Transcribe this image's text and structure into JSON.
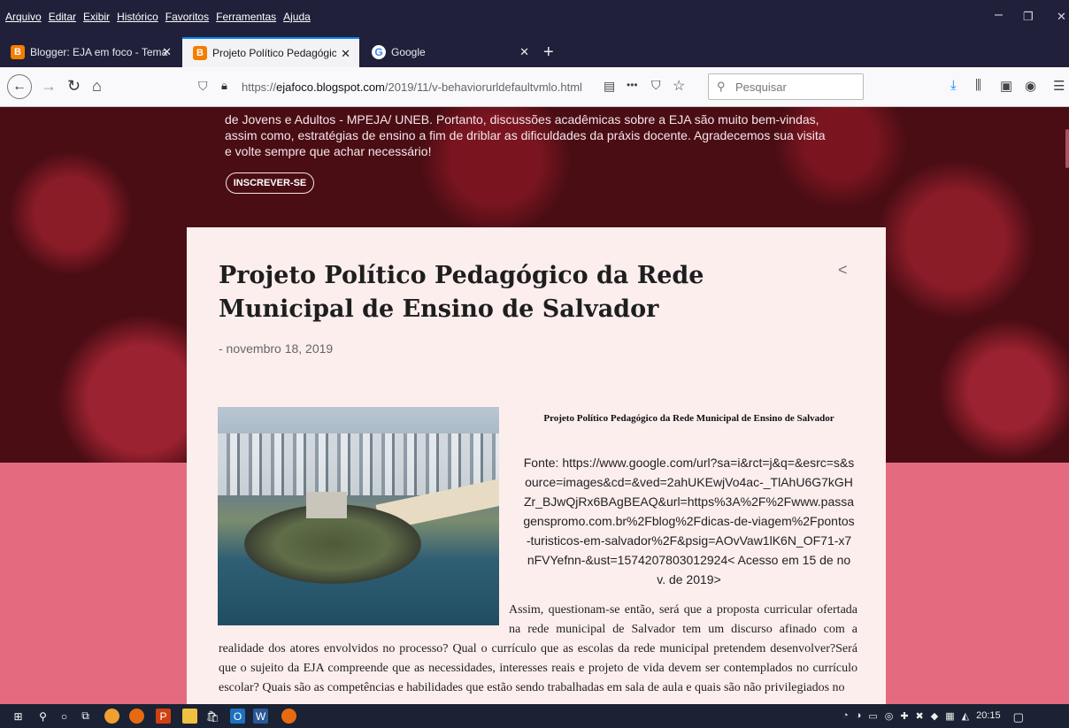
{
  "menu": [
    "Arquivo",
    "Editar",
    "Exibir",
    "Histórico",
    "Favoritos",
    "Ferramentas",
    "Ajuda"
  ],
  "window_controls": {
    "minimize": "–",
    "restore": "❐",
    "close": "✕"
  },
  "tabs": [
    {
      "title": "Blogger: EJA em foco - Tema",
      "favicon": "blogger-icon",
      "active": false
    },
    {
      "title": "Projeto Político Pedagógico da",
      "favicon": "blogger-icon",
      "active": true
    },
    {
      "title": "Google",
      "favicon": "google-icon",
      "active": false
    }
  ],
  "new_tab_label": "+",
  "nav": {
    "url_prefix": "https://",
    "url_host": "ejafoco.blogspot.com",
    "url_path": "/2019/11/v-behaviorurldefaultvmlo.html",
    "search_placeholder": "Pesquisar",
    "more_label": "•••"
  },
  "blog": {
    "description": "de Jovens e Adultos - MPEJA/ UNEB. Portanto, discussões acadêmicas sobre a EJA são muito bem-vindas, assim como, estratégias de ensino a fim de driblar as dificuldades da práxis docente. Agradecemos sua visita e volte sempre que achar necessário!",
    "subscribe_label": "INSCREVER-SE"
  },
  "post": {
    "title": "Projeto Político Pedagógico da Rede Municipal de Ensino de Salvador",
    "date": "- novembro 18, 2019",
    "caption_title": "Projeto Político Pedagógico da Rede Municipal de Ensino de Salvador",
    "source": "Fonte: https://www.google.com/url?sa=i&rct=j&q=&esrc=s&source=images&cd=&ved=2ahUKEwjVo4ac-_TlAhU6G7kGHZr_BJwQjRx6BAgBEAQ&url=https%3A%2F%2Fwww.passagenspromo.com.br%2Fblog%2Fdicas-de-viagem%2Fpontos-turisticos-em-salvador%2F&psig=AOvVaw1lK6N_OF71-x7nFVYefnn-&ust=1574207803012924< Acesso em 15 de nov. de 2019>",
    "body_part1": "Assim, questionam-se então, será que a proposta curricular ofertada na rede municipal de Salvador tem um discurso afinado com a",
    "body_part2": "realidade dos atores envolvidos no processo?  Qual o currículo que as escolas da rede municipal pretendem desenvolver?Será que o sujeito da EJA compreende que as necessidades, interesses reais e projeto de vida devem ser contemplados no currículo escolar? Quais são as competências e habilidades que estão sendo trabalhadas em sala de aula e quais são não privilegiados no"
  },
  "taskbar": {
    "clock": "20:15"
  },
  "colors": {
    "accent": "#0a84ff",
    "page_bg": "#e46a80",
    "hero_bg": "#4a0d14",
    "card_bg": "#fdeeee"
  }
}
